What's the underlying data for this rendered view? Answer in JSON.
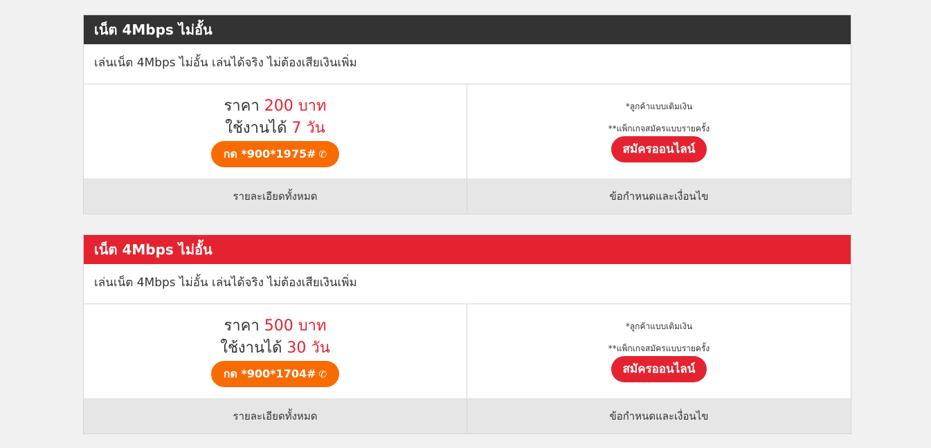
{
  "colors": {
    "header_dark": "#333333",
    "header_red": "#e52330",
    "accent_red": "#e52330",
    "dial_orange": "#f86b00"
  },
  "packages": [
    {
      "title": "เน็ต 4Mbps ไม่อั้น",
      "description": "เล่นเน็ต 4Mbps ไม่อั้น เล่นได้จริง ไม่ต้องเสียเงินเพิ่ม",
      "price_prefix": "ราคา",
      "price_value": "200 บาท",
      "duration_prefix": "ใช้งานได้",
      "duration_value": "7 วัน",
      "dial_label": "กด *900*1975#",
      "note_1": "*ลูกค้าแบบเติมเงิน",
      "note_2": "**แพ็กเกจสมัครแบบรายครั้ง",
      "signup_label": "สมัครออนไลน์",
      "details_link": "รายละเอียดทั้งหมด",
      "terms_link": "ข้อกำหนดและเงื่อนไข"
    },
    {
      "title": "เน็ต 4Mbps ไม่อั้น",
      "description": "เล่นเน็ต 4Mbps ไม่อั้น เล่นได้จริง ไม่ต้องเสียเงินเพิ่ม",
      "price_prefix": "ราคา",
      "price_value": "500 บาท",
      "duration_prefix": "ใช้งานได้",
      "duration_value": "30 วัน",
      "dial_label": "กด *900*1704#",
      "note_1": "*ลูกค้าแบบเติมเงิน",
      "note_2": "**แพ็กเกจสมัครแบบรายครั้ง",
      "signup_label": "สมัครออนไลน์",
      "details_link": "รายละเอียดทั้งหมด",
      "terms_link": "ข้อกำหนดและเงื่อนไข"
    }
  ]
}
